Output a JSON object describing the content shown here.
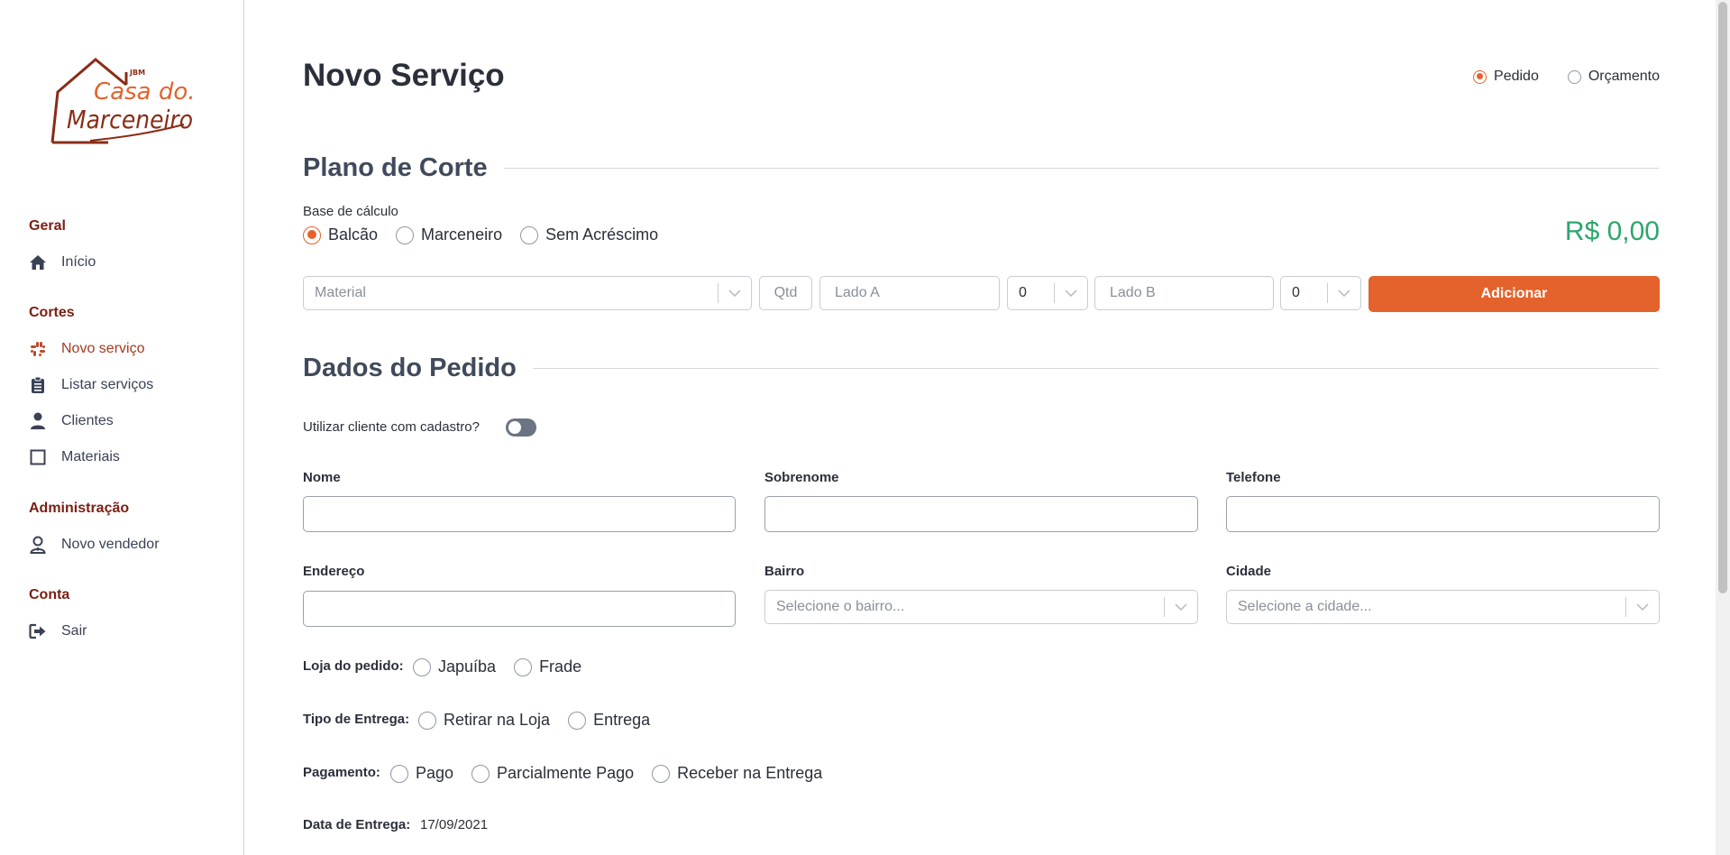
{
  "brand": {
    "logo_text_top": "JBM",
    "logo_text_line1": "Casa do.",
    "logo_text_line2": "Marceneiro",
    "color_primary": "#e4622c",
    "color_brand_dark": "#7a1f12",
    "color_price": "#2ea66d"
  },
  "sidebar": {
    "sections": [
      {
        "title": "Geral",
        "items": [
          {
            "label": "Início",
            "icon": "home-icon"
          }
        ]
      },
      {
        "title": "Cortes",
        "items": [
          {
            "label": "Novo serviço",
            "icon": "grid-icon",
            "active": true
          },
          {
            "label": "Listar serviços",
            "icon": "clipboard-icon"
          },
          {
            "label": "Clientes",
            "icon": "user-icon"
          },
          {
            "label": "Materiais",
            "icon": "square-icon"
          }
        ]
      },
      {
        "title": "Administração",
        "items": [
          {
            "label": "Novo vendedor",
            "icon": "user-tie-icon"
          }
        ]
      },
      {
        "title": "Conta",
        "items": [
          {
            "label": "Sair",
            "icon": "sign-out-icon"
          }
        ]
      }
    ]
  },
  "header": {
    "title": "Novo Serviço",
    "type_options": [
      {
        "label": "Pedido",
        "selected": true
      },
      {
        "label": "Orçamento",
        "selected": false
      }
    ]
  },
  "plano": {
    "title": "Plano de Corte",
    "base_label": "Base de cálculo",
    "base_options": [
      {
        "label": "Balcão",
        "selected": true
      },
      {
        "label": "Marceneiro",
        "selected": false
      },
      {
        "label": "Sem Acréscimo",
        "selected": false
      }
    ],
    "price": "R$ 0,00",
    "material_placeholder": "Material",
    "qtd_placeholder": "Qtd",
    "lado_a_placeholder": "Lado A",
    "lado_a_edge": "0",
    "lado_b_placeholder": "Lado B",
    "lado_b_edge": "0",
    "add_label": "Adicionar"
  },
  "pedido": {
    "title": "Dados do Pedido",
    "cliente_cadastro_label": "Utilizar cliente com cadastro?",
    "cliente_cadastro_on": false,
    "nome_label": "Nome",
    "nome_value": "",
    "sobrenome_label": "Sobrenome",
    "sobrenome_value": "",
    "telefone_label": "Telefone",
    "telefone_value": "",
    "endereco_label": "Endereço",
    "endereco_value": "",
    "bairro_label": "Bairro",
    "bairro_placeholder": "Selecione o bairro...",
    "cidade_label": "Cidade",
    "cidade_placeholder": "Selecione a cidade...",
    "loja_label": "Loja do pedido:",
    "loja_options": [
      {
        "label": "Japuíba"
      },
      {
        "label": "Frade"
      }
    ],
    "entrega_label": "Tipo de Entrega:",
    "entrega_options": [
      {
        "label": "Retirar na Loja"
      },
      {
        "label": "Entrega"
      }
    ],
    "pagamento_label": "Pagamento:",
    "pagamento_options": [
      {
        "label": "Pago"
      },
      {
        "label": "Parcialmente Pago"
      },
      {
        "label": "Receber na Entrega"
      }
    ],
    "data_entrega_label": "Data de Entrega:",
    "data_entrega_value": "17/09/2021"
  }
}
